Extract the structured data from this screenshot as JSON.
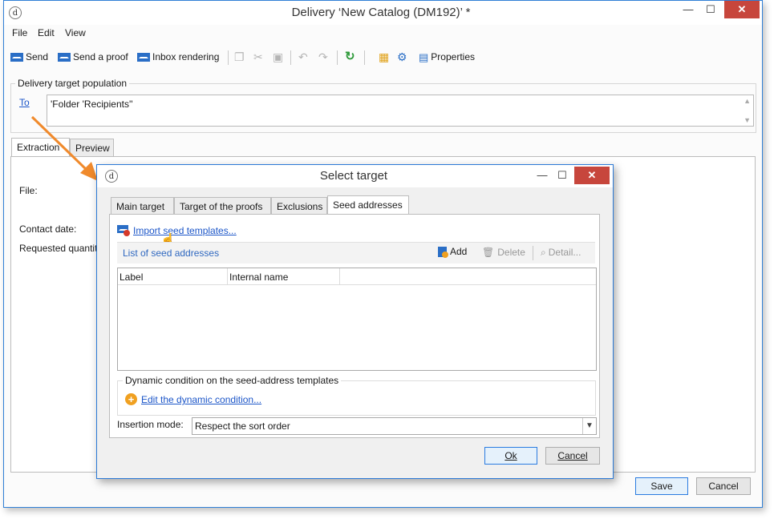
{
  "window": {
    "title": "Delivery ‘New Catalog (DM192)’ *",
    "menu": [
      "File",
      "Edit",
      "View"
    ]
  },
  "toolbar": {
    "send": "Send",
    "send_proof": "Send a proof",
    "inbox_rendering": "Inbox rendering",
    "properties": "Properties"
  },
  "target_population": {
    "group_label": "Delivery target population",
    "to_link": "To",
    "to_value": "'Folder 'Recipients''"
  },
  "main_tabs": [
    "Extraction",
    "Preview"
  ],
  "extraction_fields": {
    "file": "File:",
    "contact_date": "Contact date:",
    "requested_quantity": "Requested quantit"
  },
  "main_buttons": {
    "save": "Save",
    "cancel": "Cancel"
  },
  "dialog": {
    "title": "Select target",
    "tabs": [
      "Main target",
      "Target of the proofs",
      "Exclusions",
      "Seed addresses"
    ],
    "active_tab": "Seed addresses",
    "import_link": "Import seed templates...",
    "list_title": "List of seed addresses",
    "list_actions": {
      "add": "Add",
      "delete": "Delete",
      "detail": "Detail..."
    },
    "columns": [
      "Label",
      "Internal name"
    ],
    "dynamic_group_label": "Dynamic condition on the seed-address templates",
    "dynamic_link": "Edit the dynamic condition...",
    "insertion_label": "Insertion mode:",
    "insertion_value": "Respect the sort order",
    "ok": "Ok",
    "cancel": "Cancel"
  },
  "colors": {
    "accent": "#2b79d6",
    "link": "#1b55c8",
    "close": "#c7463c",
    "arrow": "#f08a2c"
  }
}
